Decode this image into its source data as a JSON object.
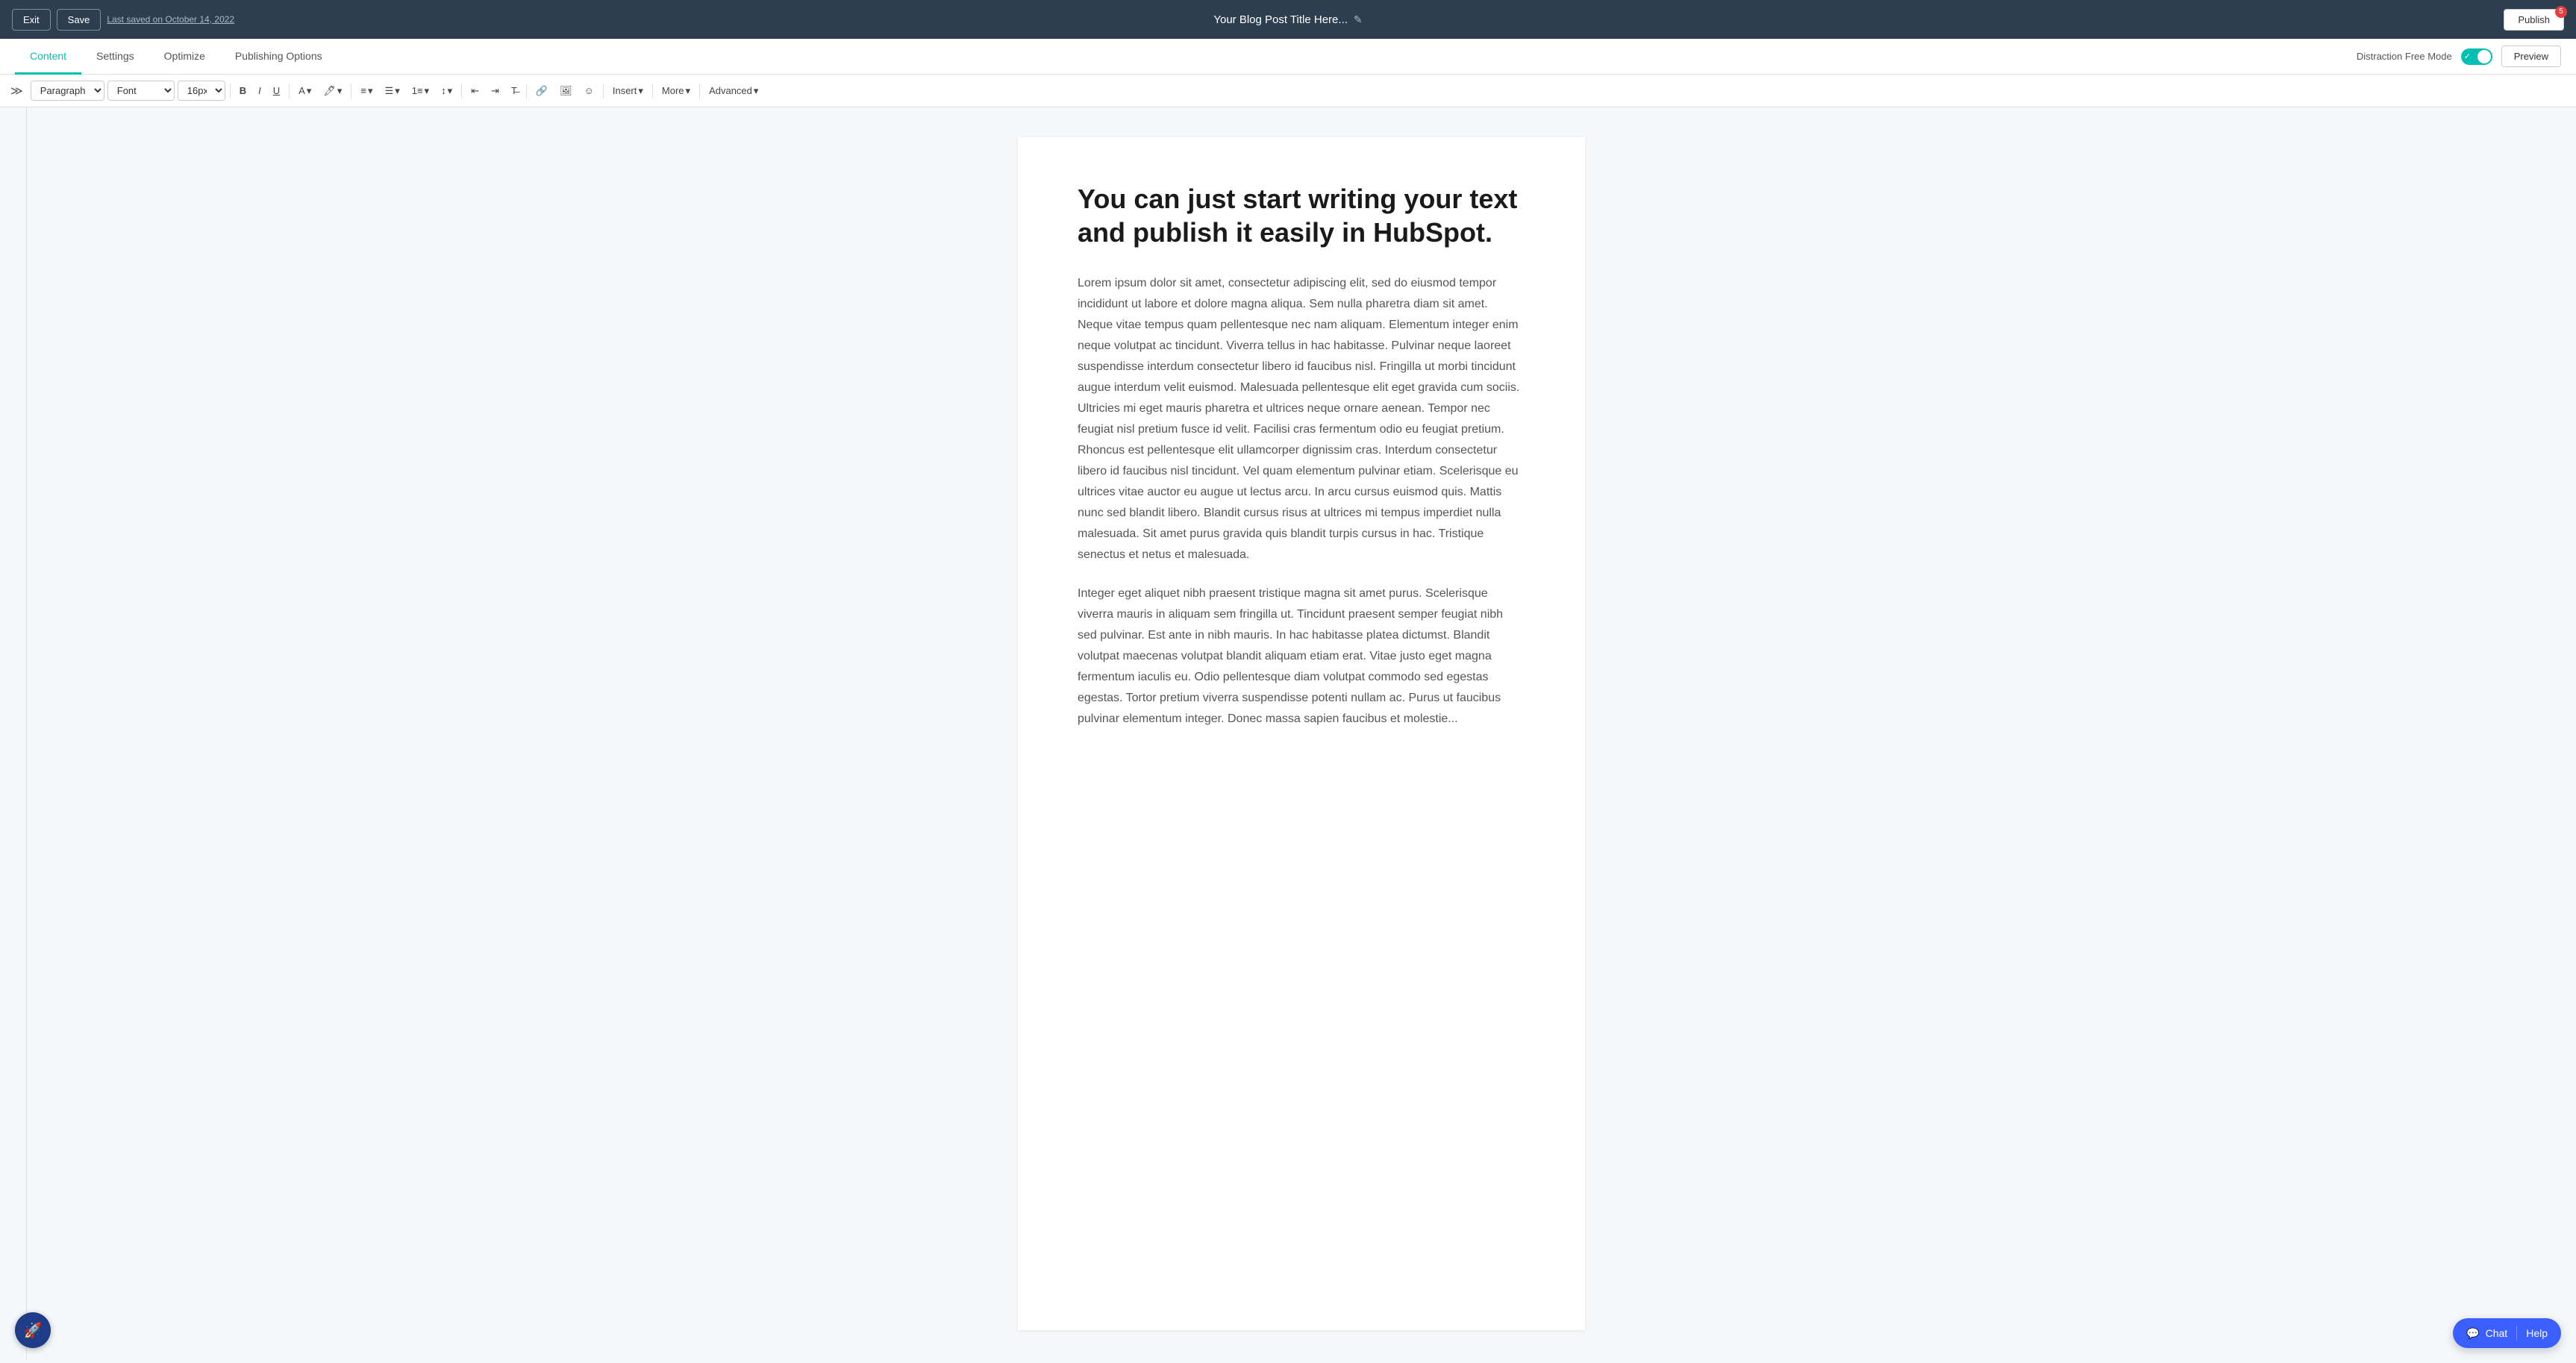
{
  "topbar": {
    "exit_label": "Exit",
    "save_label": "Save",
    "last_saved": "Last saved on October 14, 2022",
    "page_title": "Your Blog Post Title Here...",
    "edit_icon": "✎",
    "publish_label": "Publish",
    "notification_count": "5"
  },
  "tabs": {
    "items": [
      {
        "id": "content",
        "label": "Content",
        "active": true
      },
      {
        "id": "settings",
        "label": "Settings",
        "active": false
      },
      {
        "id": "optimize",
        "label": "Optimize",
        "active": false
      },
      {
        "id": "publishing-options",
        "label": "Publishing Options",
        "active": false
      }
    ],
    "distraction_free_label": "Distraction Free Mode",
    "preview_label": "Preview"
  },
  "toolbar": {
    "expand_icon": "≫",
    "paragraph_label": "Paragraph",
    "font_label": "Font",
    "font_size_label": "16px",
    "bold_label": "B",
    "italic_label": "I",
    "underline_label": "U",
    "more_label": "More",
    "advanced_label": "Advanced",
    "insert_label": "Insert",
    "chevron": "▾"
  },
  "editor": {
    "heading": "You can just start writing your text and publish it easily in HubSpot.",
    "paragraph1": "Lorem ipsum dolor sit amet, consectetur adipiscing elit, sed do eiusmod tempor incididunt ut labore et dolore magna aliqua. Sem nulla pharetra diam sit amet. Neque vitae tempus quam pellentesque nec nam aliquam. Elementum integer enim neque volutpat ac tincidunt. Viverra tellus in hac habitasse. Pulvinar neque laoreet suspendisse interdum consectetur libero id faucibus nisl. Fringilla ut morbi tincidunt augue interdum velit euismod. Malesuada pellentesque elit eget gravida cum sociis. Ultricies mi eget mauris pharetra et ultrices neque ornare aenean. Tempor nec feugiat nisl pretium fusce id velit. Facilisi cras fermentum odio eu feugiat pretium. Rhoncus est pellentesque elit ullamcorper dignissim cras. Interdum consectetur libero id faucibus nisl tincidunt. Vel quam elementum pulvinar etiam. Scelerisque eu ultrices vitae auctor eu augue ut lectus arcu. In arcu cursus euismod quis. Mattis nunc sed blandit libero. Blandit cursus risus at ultrices mi tempus imperdiet nulla malesuada. Sit amet purus gravida quis blandit turpis cursus in hac. Tristique senectus et netus et malesuada.",
    "paragraph2": "Integer eget aliquet nibh praesent tristique magna sit amet purus. Scelerisque viverra mauris in aliquam sem fringilla ut. Tincidunt praesent semper feugiat nibh sed pulvinar. Est ante in nibh mauris. In hac habitasse platea dictumst. Blandit volutpat maecenas volutpat blandit aliquam etiam erat. Vitae justo eget magna fermentum iaculis eu. Odio pellentesque diam volutpat commodo sed egestas egestas. Tortor pretium viverra suspendisse potenti nullam ac. Purus ut faucibus pulvinar elementum integer. Donec massa sapien faucibus et molestie..."
  },
  "chat": {
    "chat_label": "Chat",
    "help_label": "Help",
    "chat_icon": "💬"
  },
  "bot": {
    "icon": "🚀"
  }
}
